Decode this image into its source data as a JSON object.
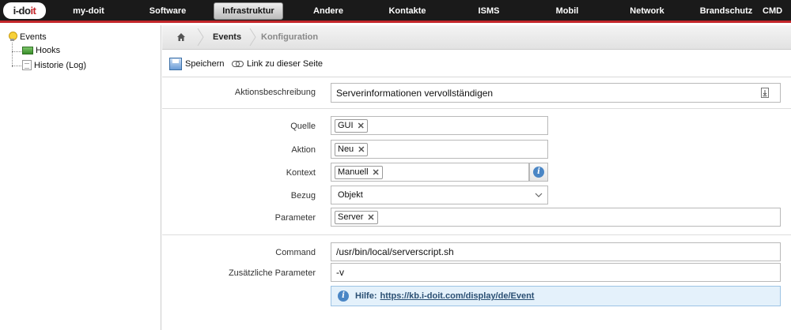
{
  "logo": {
    "part1": "i-do",
    "part2": "it"
  },
  "nav": {
    "items": [
      "my-doit",
      "Software",
      "Infrastruktur",
      "Andere",
      "Kontakte",
      "ISMS",
      "Mobil",
      "Network",
      "Brandschutz",
      "CMD"
    ]
  },
  "tree": {
    "root": "Events",
    "children": [
      "Hooks",
      "Historie (Log)"
    ]
  },
  "breadcrumb": {
    "items": [
      "Events",
      "Konfiguration"
    ]
  },
  "toolbar": {
    "save_label": "Speichern",
    "link_label": "Link zu dieser Seite"
  },
  "form": {
    "description": {
      "label": "Aktionsbeschreibung",
      "value": "Serverinformationen vervollständigen"
    },
    "quelle": {
      "label": "Quelle",
      "tag": "GUI"
    },
    "aktion": {
      "label": "Aktion",
      "tag": "Neu"
    },
    "kontext": {
      "label": "Kontext",
      "tag": "Manuell"
    },
    "bezug": {
      "label": "Bezug",
      "value": "Objekt"
    },
    "parameter": {
      "label": "Parameter",
      "tag": "Server"
    },
    "command": {
      "label": "Command",
      "value": "/usr/bin/local/serverscript.sh"
    },
    "extra_params": {
      "label": "Zusätzliche Parameter",
      "value": "-v"
    },
    "help": {
      "prefix": "Hilfe:",
      "link": "https://kb.i-doit.com/display/de/Event"
    }
  },
  "colors": {
    "nav_bg": "#1a1a1a",
    "accent_red": "#c3262a",
    "info_blue": "#4a86c5",
    "help_bg": "#e4f1fb"
  }
}
